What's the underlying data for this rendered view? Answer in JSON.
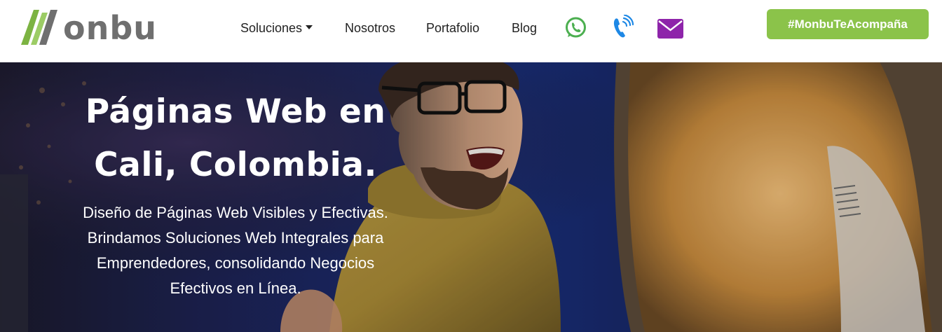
{
  "brand": {
    "name": "onbu",
    "colors": {
      "green": "#8bc34a",
      "gray": "#6f6f6f"
    }
  },
  "nav": {
    "items": [
      {
        "label": "Soluciones"
      },
      {
        "label": "Nosotros"
      },
      {
        "label": "Portafolio"
      },
      {
        "label": "Blog"
      }
    ],
    "icons": [
      "whatsapp-icon",
      "phone-icon",
      "mail-icon"
    ]
  },
  "cta": {
    "label": "#MonbuTeAcompaña"
  },
  "hero": {
    "title_line1": "Páginas Web en",
    "title_line2": "Cali, Colombia.",
    "description": "Diseño de Páginas Web Visibles y Efectivas. Brindamos Soluciones Web Integrales para Emprendedores, consolidando Negocios Efectivos en Línea."
  },
  "colors": {
    "whatsapp": "#4caf50",
    "phone": "#1e88e5",
    "mail": "#8e24aa",
    "cta": "#8bc34a"
  }
}
